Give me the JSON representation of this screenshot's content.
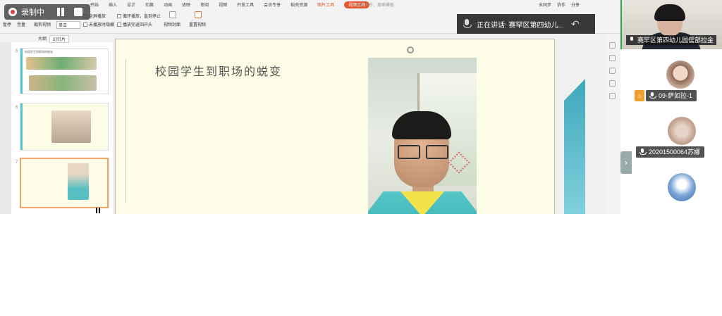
{
  "recording": {
    "label": "录制中"
  },
  "ribbon": {
    "menu": [
      "开始",
      "插入",
      "设计",
      "切换",
      "动画",
      "放映",
      "审阅",
      "视图",
      "开发工具",
      "会员专享",
      "稻壳资源",
      "图片工具"
    ],
    "active_menu": "视频工具",
    "search_placeholder": "查找命令、搜索模板",
    "right_tools": [
      "未同步",
      "协作",
      "分享"
    ],
    "tools": {
      "pause": "暂停",
      "volume": "音量",
      "trim": "裁剪视频",
      "single_label": "单击",
      "fullscreen": "全屏播放",
      "loop": "循环播放，直到停止",
      "hide_when_not_playing": "未播放时隐藏",
      "rewind": "播放完返回开头",
      "cover": "视频封面",
      "reset": "重置视频"
    }
  },
  "speaker": {
    "text": "正在讲话: 赛罕区第四幼儿..."
  },
  "left_panel": {
    "tabs": [
      "大纲",
      "幻灯片"
    ],
    "thumbnails": [
      {
        "num": "5",
        "title": "校园学生到职场的蜕变"
      },
      {
        "num": "6",
        "title": ""
      },
      {
        "num": "7",
        "title": ""
      }
    ]
  },
  "slide": {
    "title": "校园学生到职场的蜕变"
  },
  "camera_tile": {
    "name": "赛罕区第四幼儿园儒部拉金"
  },
  "participants": [
    {
      "name": "09-萨如拉-1",
      "host": true
    },
    {
      "name": "20201500064苏娜",
      "host": false
    },
    {
      "name": "",
      "host": false
    }
  ],
  "colors": {
    "accent": "#e5562a",
    "cyan": "#45c4da",
    "slide_bg": "#fdfce6"
  }
}
